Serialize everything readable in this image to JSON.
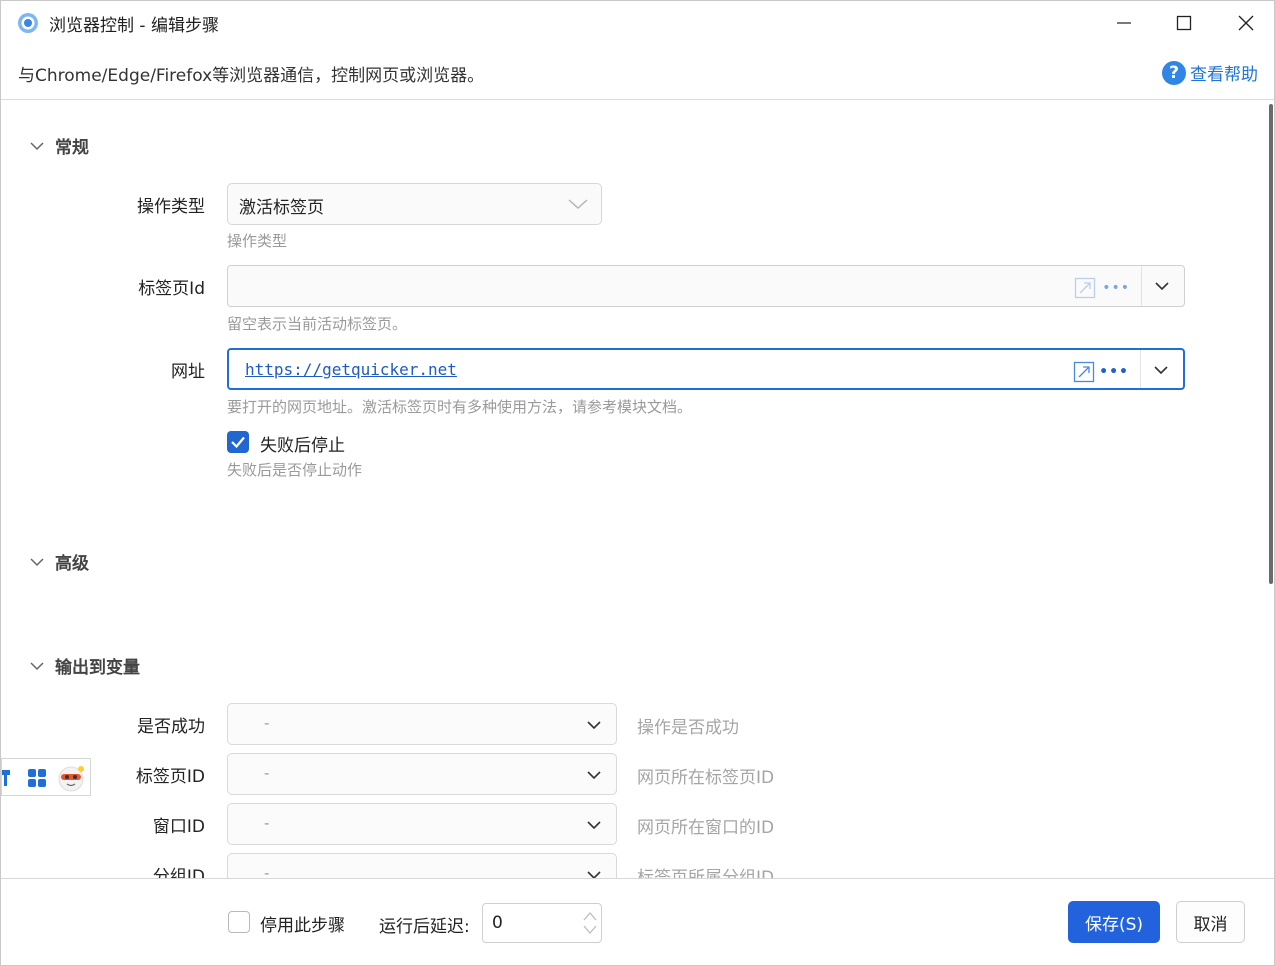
{
  "window": {
    "title": "浏览器控制  -  编辑步骤"
  },
  "description": {
    "text": "与Chrome/Edge/Firefox等浏览器通信，控制网页或浏览器。",
    "help_label": "查看帮助",
    "help_icon": "?"
  },
  "general": {
    "title": "常规",
    "operation_type": {
      "label": "操作类型",
      "value": "激活标签页",
      "hint": "操作类型"
    },
    "tab_id": {
      "label": "标签页Id",
      "value": "",
      "hint": "留空表示当前活动标签页。"
    },
    "url": {
      "label": "网址",
      "value": "https://getquicker.net",
      "hint": "要打开的网页地址。激活标签页时有多种使用方法，请参考模块文档。"
    },
    "stop_on_fail": {
      "label": "失败后停止",
      "checked": true,
      "hint": "失败后是否停止动作"
    }
  },
  "advanced": {
    "title": "高级"
  },
  "output": {
    "title": "输出到变量",
    "rows": [
      {
        "label": "是否成功",
        "value": "-",
        "hint": "操作是否成功"
      },
      {
        "label": "标签页ID",
        "value": "-",
        "hint": "网页所在标签页ID"
      },
      {
        "label": "窗口ID",
        "value": "-",
        "hint": "网页所在窗口的ID"
      },
      {
        "label": "分组ID",
        "value": "-",
        "hint": "标签页所属分组ID"
      }
    ]
  },
  "combo_dots": "•••",
  "footer": {
    "disable_label": "停用此步骤",
    "disable_checked": false,
    "delay_label": "运行后延迟:",
    "delay_value": "0",
    "save_label": "保存(S)",
    "cancel_label": "取消"
  },
  "colors": {
    "accent": "#2263dd",
    "link": "#1e5bc4",
    "help": "#1e73d6"
  }
}
